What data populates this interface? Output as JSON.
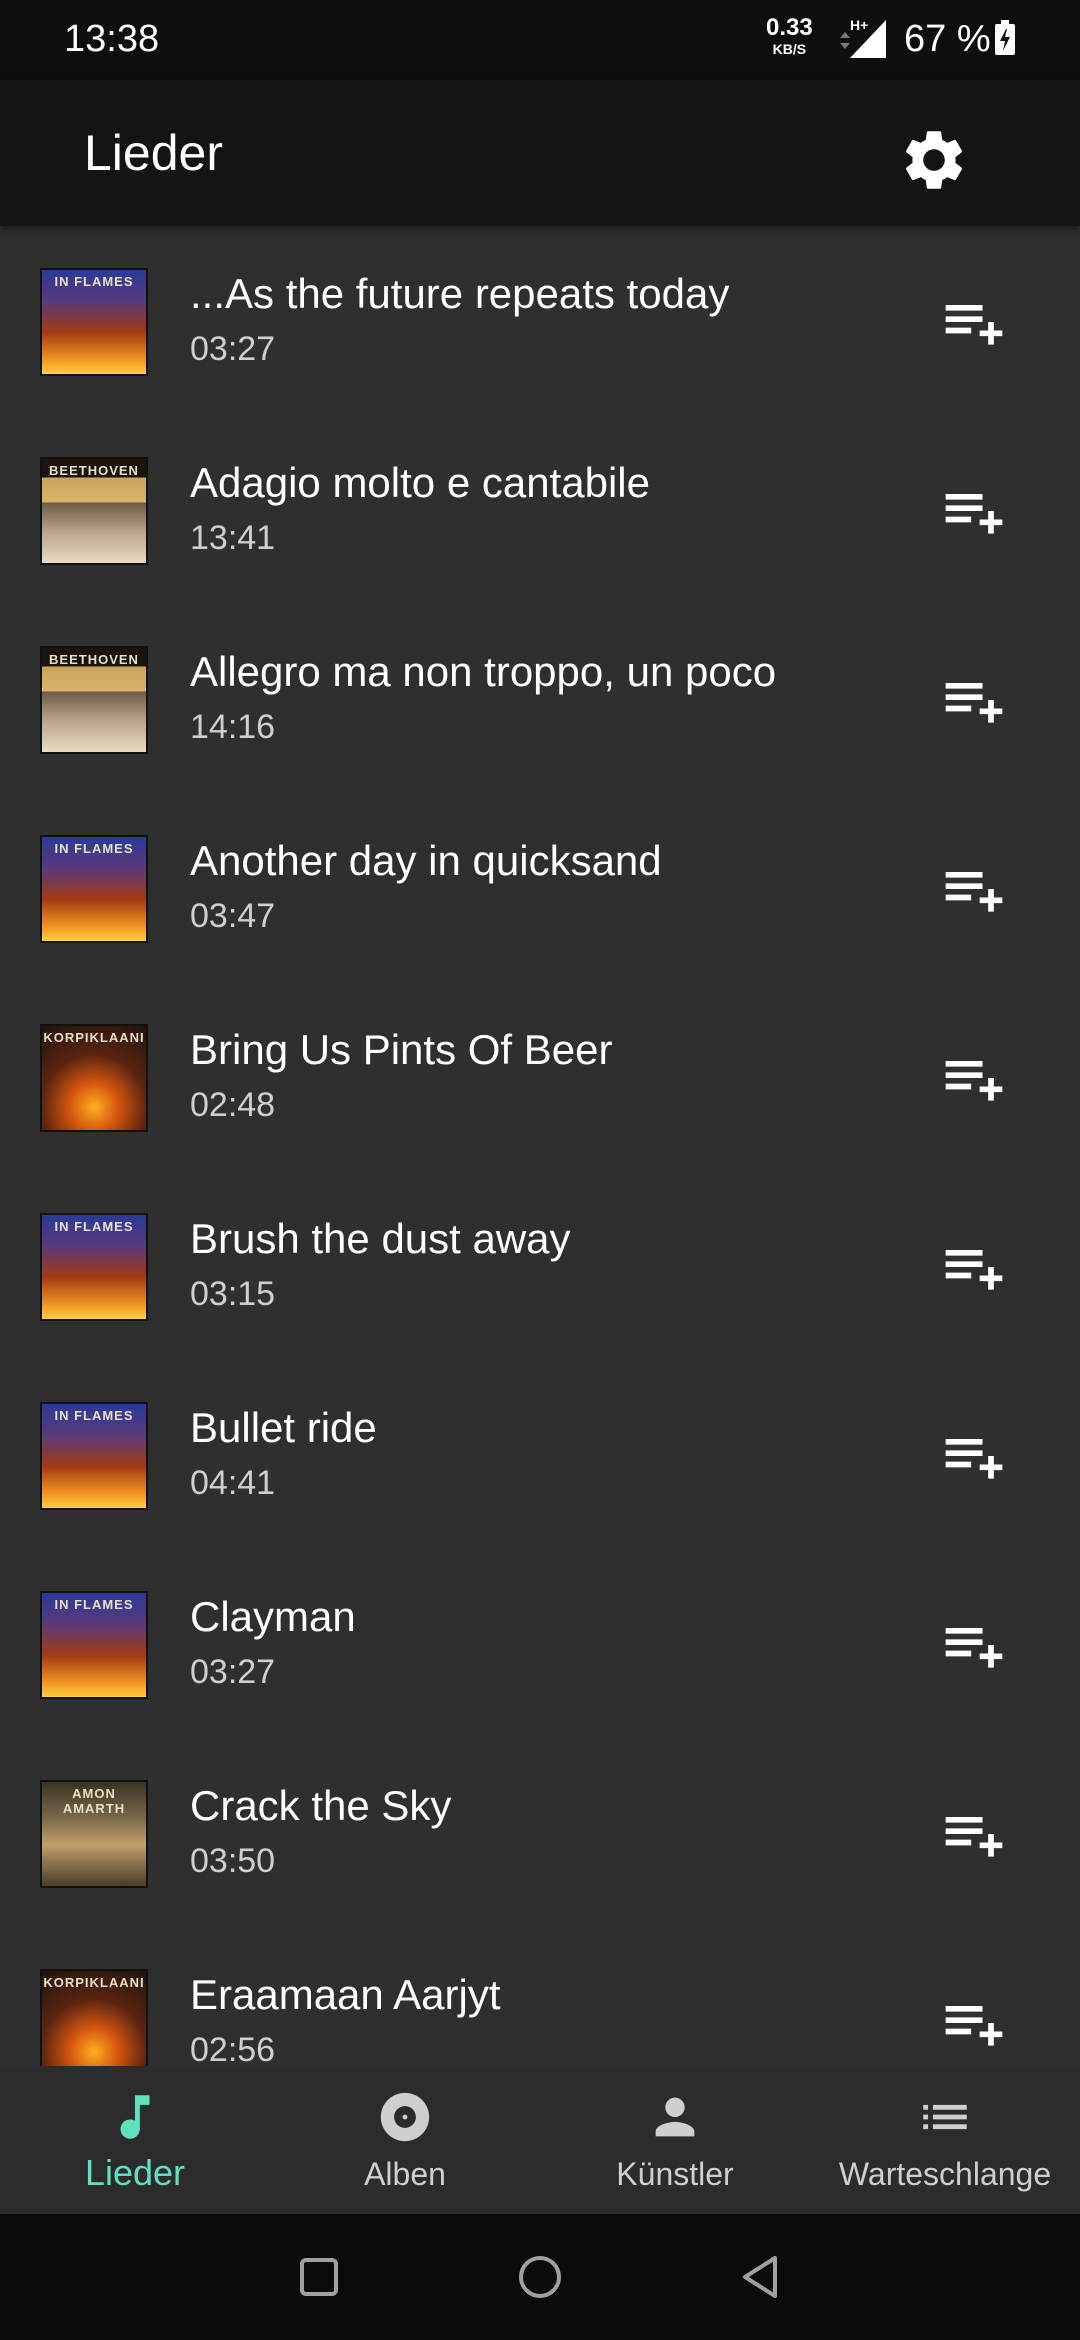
{
  "status_bar": {
    "time": "13:38",
    "speed_value": "0.33",
    "speed_unit": "KB/S",
    "network_type": "H+",
    "battery_percent": "67 %"
  },
  "app_bar": {
    "title": "Lieder",
    "settings_icon": "gear-icon"
  },
  "songs": [
    {
      "title": "...As the future repeats today",
      "duration": "03:27",
      "cover": "in-flames"
    },
    {
      "title": "Adagio molto e cantabile",
      "duration": "13:41",
      "cover": "beethoven"
    },
    {
      "title": "Allegro ma non troppo, un poco",
      "duration": "14:16",
      "cover": "beethoven"
    },
    {
      "title": "Another day in quicksand",
      "duration": "03:47",
      "cover": "in-flames"
    },
    {
      "title": "Bring Us Pints Of Beer",
      "duration": "02:48",
      "cover": "korpiklaani"
    },
    {
      "title": "Brush the dust away",
      "duration": "03:15",
      "cover": "in-flames"
    },
    {
      "title": "Bullet ride",
      "duration": "04:41",
      "cover": "in-flames"
    },
    {
      "title": "Clayman",
      "duration": "03:27",
      "cover": "in-flames"
    },
    {
      "title": "Crack the Sky",
      "duration": "03:50",
      "cover": "amon-amarth"
    },
    {
      "title": "Eraamaan Aarjyt",
      "duration": "02:56",
      "cover": "korpiklaani"
    }
  ],
  "cover_logos": {
    "in-flames": "IN FLAMES",
    "beethoven": "BEETHOVEN",
    "korpiklaani": "KORPIKLAANI",
    "amon-amarth": "AMON AMARTH"
  },
  "bottom_nav": {
    "items": [
      {
        "label": "Lieder",
        "icon": "music-note-icon",
        "active": true
      },
      {
        "label": "Alben",
        "icon": "album-disc-icon",
        "active": false
      },
      {
        "label": "Künstler",
        "icon": "person-icon",
        "active": false
      },
      {
        "label": "Warteschlange",
        "icon": "queue-list-icon",
        "active": false
      }
    ]
  },
  "colors": {
    "background": "#2f2f2f",
    "app_bar": "#141414",
    "accent": "#5fe0bf",
    "text_secondary": "#cfcfcf"
  }
}
